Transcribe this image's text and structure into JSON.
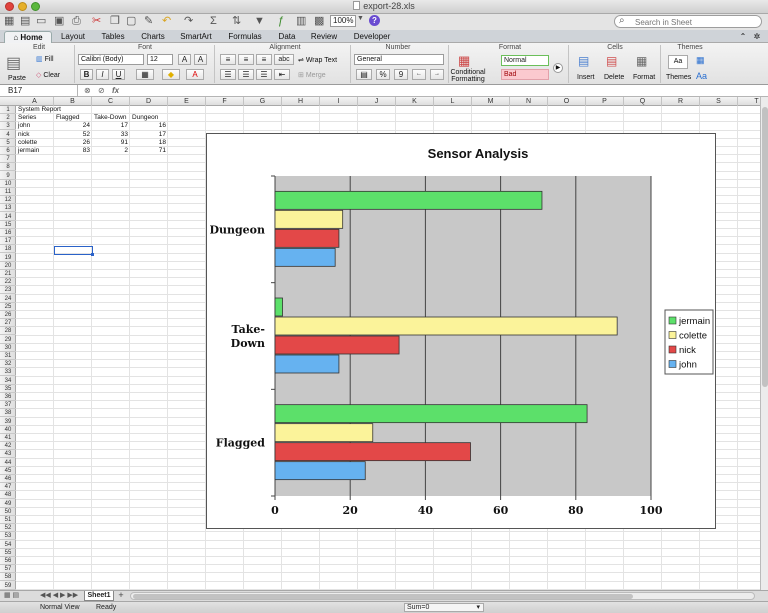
{
  "window": {
    "title": "export-28.xls"
  },
  "toolbar": {
    "zoom": "100%",
    "search_placeholder": "Search in Sheet"
  },
  "ribbon": {
    "tabs": [
      "Home",
      "Layout",
      "Tables",
      "Charts",
      "SmartArt",
      "Formulas",
      "Data",
      "Review",
      "Developer"
    ],
    "groups": {
      "edit": "Edit",
      "font": "Font",
      "alignment": "Alignment",
      "number": "Number",
      "format": "Format",
      "cells": "Cells",
      "themes": "Themes"
    },
    "paste": "Paste",
    "fill": "Fill",
    "clear": "Clear",
    "font_name": "Calibri (Body)",
    "font_size": "12",
    "bold": "B",
    "italic": "I",
    "underline": "U",
    "wrap_text": "Wrap Text",
    "merge": "Merge",
    "abc": "abc",
    "number_format": "General",
    "percent": "%",
    "comma": "9",
    "cond_formatting": [
      "Conditional",
      "Formatting"
    ],
    "style_normal": "Normal",
    "style_bad": "Bad",
    "insert": "Insert",
    "delete": "Delete",
    "format_btn": "Format",
    "themes_btn": "Themes",
    "aa": "Aa"
  },
  "formula_bar": {
    "cell_ref": "B17",
    "fx": "fx"
  },
  "sheet": {
    "columns": [
      "A",
      "B",
      "C",
      "D",
      "E",
      "F",
      "G",
      "H",
      "I",
      "J",
      "K",
      "L",
      "M",
      "N",
      "O",
      "P",
      "Q",
      "R",
      "S",
      "T"
    ],
    "row_count": 60,
    "cells": [
      {
        "row": 1,
        "col": 0,
        "text": "System Report",
        "num": false
      },
      {
        "row": 2,
        "col": 0,
        "text": "Series",
        "num": false
      },
      {
        "row": 2,
        "col": 1,
        "text": "Flagged",
        "num": false
      },
      {
        "row": 2,
        "col": 2,
        "text": "Take-Down",
        "num": false
      },
      {
        "row": 2,
        "col": 3,
        "text": "Dungeon",
        "num": false
      },
      {
        "row": 3,
        "col": 0,
        "text": "john",
        "num": false
      },
      {
        "row": 3,
        "col": 1,
        "text": "24",
        "num": true
      },
      {
        "row": 3,
        "col": 2,
        "text": "17",
        "num": true
      },
      {
        "row": 3,
        "col": 3,
        "text": "16",
        "num": true
      },
      {
        "row": 4,
        "col": 0,
        "text": "nick",
        "num": false
      },
      {
        "row": 4,
        "col": 1,
        "text": "52",
        "num": true
      },
      {
        "row": 4,
        "col": 2,
        "text": "33",
        "num": true
      },
      {
        "row": 4,
        "col": 3,
        "text": "17",
        "num": true
      },
      {
        "row": 5,
        "col": 0,
        "text": "colette",
        "num": false
      },
      {
        "row": 5,
        "col": 1,
        "text": "26",
        "num": true
      },
      {
        "row": 5,
        "col": 2,
        "text": "91",
        "num": true
      },
      {
        "row": 5,
        "col": 3,
        "text": "18",
        "num": true
      },
      {
        "row": 6,
        "col": 0,
        "text": "jermain",
        "num": false
      },
      {
        "row": 6,
        "col": 1,
        "text": "83",
        "num": true
      },
      {
        "row": 6,
        "col": 2,
        "text": "2",
        "num": true
      },
      {
        "row": 6,
        "col": 3,
        "text": "71",
        "num": true
      }
    ]
  },
  "chart_data": {
    "type": "bar",
    "orientation": "horizontal",
    "title": "Sensor Analysis",
    "categories": [
      "Dungeon",
      "Take-Down",
      "Flagged"
    ],
    "series": [
      {
        "name": "jermain",
        "color": "#5ce06a",
        "values": [
          71,
          2,
          83
        ]
      },
      {
        "name": "colette",
        "color": "#fbf39a",
        "values": [
          18,
          91,
          26
        ]
      },
      {
        "name": "nick",
        "color": "#e34848",
        "values": [
          17,
          33,
          52
        ]
      },
      {
        "name": "john",
        "color": "#66b2f0",
        "values": [
          16,
          17,
          24
        ]
      }
    ],
    "xlim": [
      0,
      100
    ],
    "xticks": [
      "0",
      "20",
      "40",
      "60",
      "80",
      "100"
    ],
    "grid": true,
    "plot_background": "#c8c8c8",
    "legend": "right"
  },
  "sheet_tabs": {
    "active": "Sheet1",
    "add": "+"
  },
  "status": {
    "view": "Normal View",
    "state": "Ready",
    "sum": "Sum=0"
  }
}
